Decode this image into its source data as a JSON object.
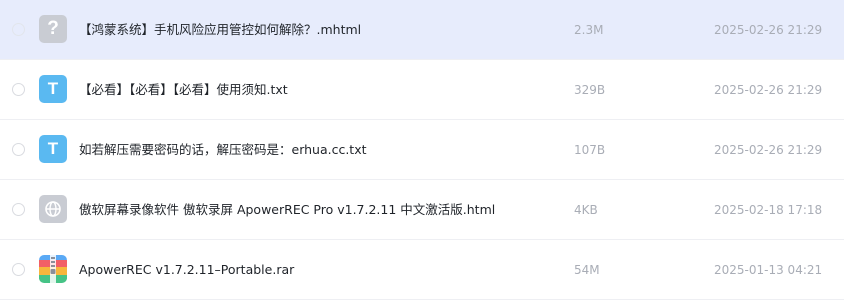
{
  "files": [
    {
      "icon": "question-file-icon",
      "glyph": "?",
      "name": "【鸿蒙系统】手机风险应用管控如何解除？.mhtml",
      "size": "2.3M",
      "date": "2025-02-26 21:29",
      "selected": true
    },
    {
      "icon": "txt-file-icon",
      "glyph": "T",
      "name": "【必看】【必看】【必看】使用须知.txt",
      "size": "329B",
      "date": "2025-02-26 21:29"
    },
    {
      "icon": "txt-file-icon",
      "glyph": "T",
      "name": "如若解压需要密码的话，解压密码是：erhua.cc.txt",
      "size": "107B",
      "date": "2025-02-26 21:29"
    },
    {
      "icon": "globe-file-icon",
      "glyph": "",
      "name": "傲软屏幕录像软件 傲软录屏 ApowerREC Pro v1.7.2.11 中文激活版.html",
      "size": "4KB",
      "date": "2025-02-18 17:18"
    },
    {
      "icon": "archive-file-icon",
      "glyph": "",
      "name": "ApowerREC v1.7.2.11–Portable.rar",
      "size": "54M",
      "date": "2025-01-13 04:21"
    }
  ],
  "colors": {
    "selected_row": "#edf1fd",
    "txt_icon": "#5ab9f1",
    "generic_icon": "#c9ccd3",
    "meta_text": "#a9adb6"
  }
}
